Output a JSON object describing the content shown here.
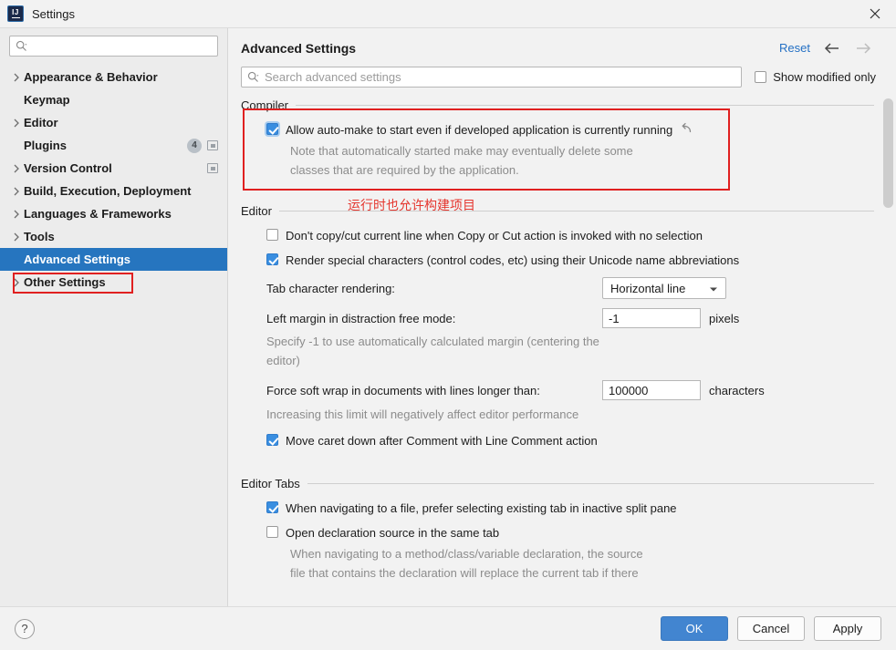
{
  "window": {
    "title": "Settings",
    "logo_icon": "intellij-idea-logo",
    "close_icon": "close-icon"
  },
  "sidebar": {
    "search": {
      "placeholder": "",
      "value": "",
      "icon": "search-icon"
    },
    "items": [
      {
        "label": "Appearance & Behavior",
        "expandable": true,
        "selected": false,
        "badge": "",
        "extra_icon": ""
      },
      {
        "label": "Keymap",
        "expandable": false,
        "selected": false,
        "badge": "",
        "extra_icon": ""
      },
      {
        "label": "Editor",
        "expandable": true,
        "selected": false,
        "badge": "",
        "extra_icon": ""
      },
      {
        "label": "Plugins",
        "expandable": false,
        "selected": false,
        "badge": "4",
        "extra_icon": "project-scope-icon"
      },
      {
        "label": "Version Control",
        "expandable": true,
        "selected": false,
        "badge": "",
        "extra_icon": "project-scope-icon"
      },
      {
        "label": "Build, Execution, Deployment",
        "expandable": true,
        "selected": false,
        "badge": "",
        "extra_icon": ""
      },
      {
        "label": "Languages & Frameworks",
        "expandable": true,
        "selected": false,
        "badge": "",
        "extra_icon": ""
      },
      {
        "label": "Tools",
        "expandable": true,
        "selected": false,
        "badge": "",
        "extra_icon": ""
      },
      {
        "label": "Advanced Settings",
        "expandable": false,
        "selected": true,
        "badge": "",
        "extra_icon": ""
      },
      {
        "label": "Other Settings",
        "expandable": true,
        "selected": false,
        "badge": "",
        "extra_icon": ""
      }
    ]
  },
  "header": {
    "title": "Advanced Settings",
    "reset_label": "Reset",
    "back_icon": "arrow-left-icon",
    "forward_icon": "arrow-right-icon"
  },
  "search": {
    "placeholder": "Search advanced settings",
    "value": "",
    "icon": "search-icon",
    "show_modified_label": "Show modified only",
    "show_modified_checked": false
  },
  "sections": {
    "compiler": {
      "title": "Compiler",
      "option_label": "Allow auto-make to start even if developed application is currently running",
      "option_checked": true,
      "revert_icon": "revert-icon",
      "hint_line1": "Note that automatically started make may eventually delete some",
      "hint_line2": "classes that are required by the application."
    },
    "editor": {
      "title": "Editor",
      "opt_dont_copy_label": "Don't copy/cut current line when Copy or Cut action is invoked with no selection",
      "opt_dont_copy_checked": false,
      "opt_render_special_label": "Render special characters (control codes, etc) using their Unicode name abbreviations",
      "opt_render_special_checked": true,
      "tab_render_label": "Tab character rendering:",
      "tab_render_value": "Horizontal line",
      "left_margin_label": "Left margin in distraction free mode:",
      "left_margin_value": "-1",
      "left_margin_unit": "pixels",
      "left_margin_hint1": "Specify -1 to use automatically calculated margin (centering the",
      "left_margin_hint2": "editor)",
      "soft_wrap_label": "Force soft wrap in documents with lines longer than:",
      "soft_wrap_value": "100000",
      "soft_wrap_unit": "characters",
      "soft_wrap_hint": "Increasing this limit will negatively affect editor performance",
      "opt_move_caret_label": "Move caret down after Comment with Line Comment action",
      "opt_move_caret_checked": true
    },
    "editor_tabs": {
      "title": "Editor Tabs",
      "opt_prefer_existing_label": "When navigating to a file, prefer selecting existing tab in inactive split pane",
      "opt_prefer_existing_checked": true,
      "opt_open_declaration_label": "Open declaration source in the same tab",
      "opt_open_declaration_checked": false,
      "hint_line1": "When navigating to a method/class/variable declaration, the source",
      "hint_line2": "file that contains the declaration will replace the current tab if there"
    }
  },
  "annotation": {
    "text": "运行时也允许构建项目",
    "color": "#e5362e"
  },
  "footer": {
    "help_label": "?",
    "ok_label": "OK",
    "cancel_label": "Cancel",
    "apply_label": "Apply"
  },
  "colors": {
    "accent": "#2675bf",
    "link": "#2470c4",
    "primary_button": "#4285d0",
    "annotation_red": "#e02020",
    "checkbox_blue": "#3a8ee0"
  }
}
